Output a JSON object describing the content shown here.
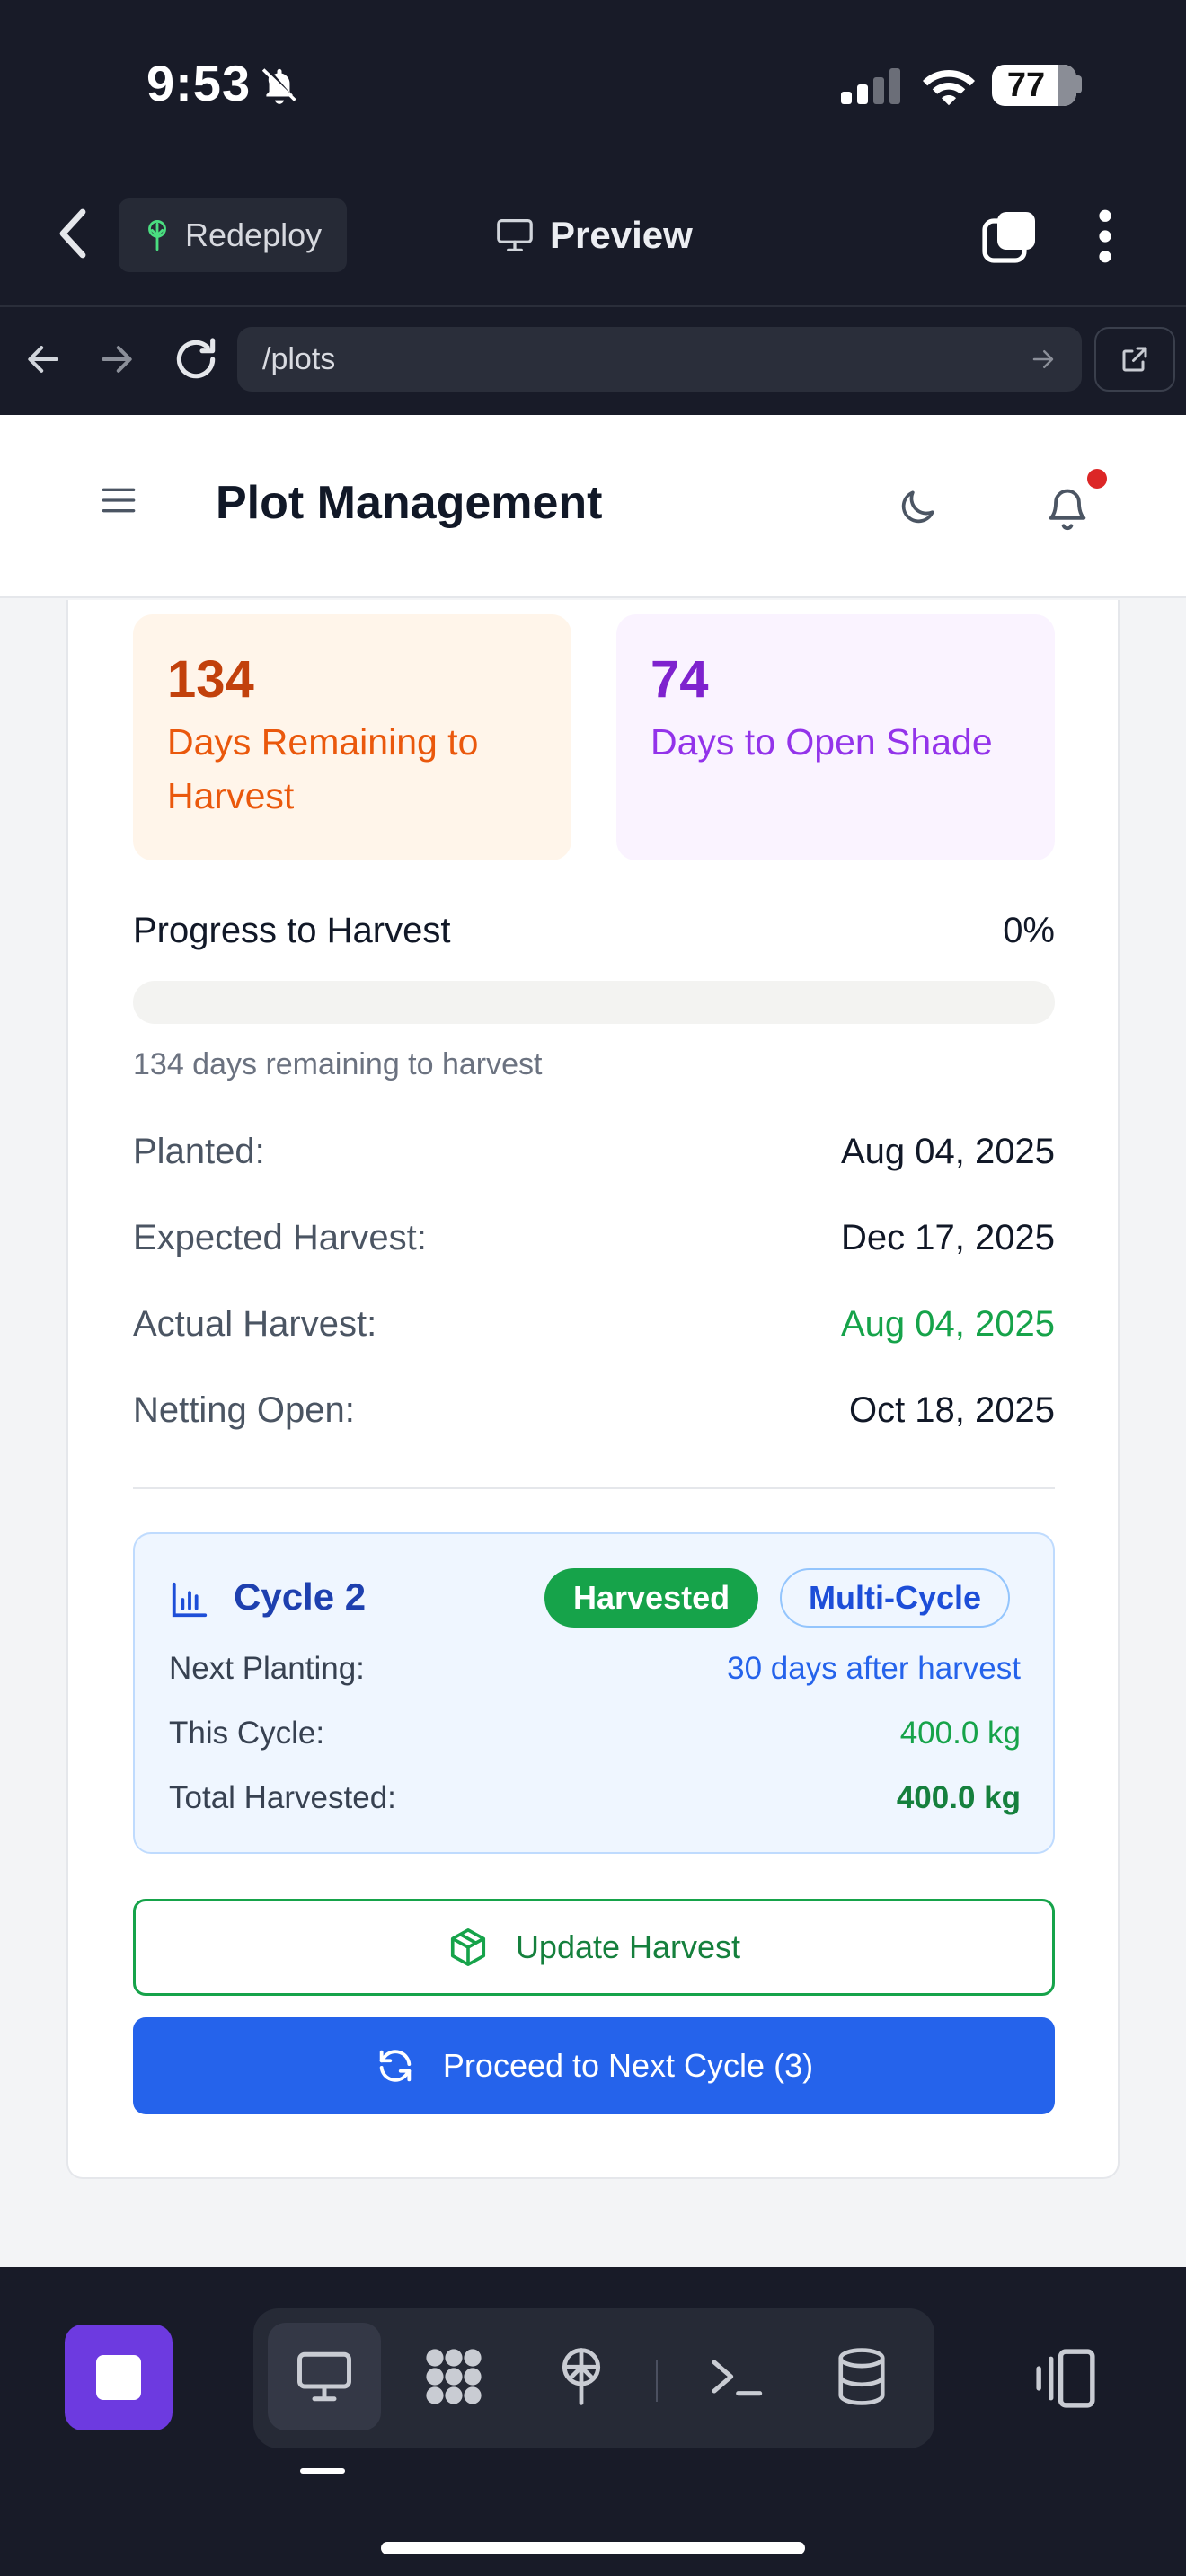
{
  "status_bar": {
    "time": "9:53",
    "battery": "77"
  },
  "browser": {
    "redeploy_label": "Redeploy",
    "preview_label": "Preview",
    "url": "/plots"
  },
  "header": {
    "title": "Plot Management"
  },
  "stats": [
    {
      "value": "134",
      "label": "Days Remaining to Harvest",
      "color": "#c2410c"
    },
    {
      "value": "74",
      "label": "Days to Open Shade",
      "color": "#7e22ce"
    }
  ],
  "progress": {
    "label": "Progress to Harvest",
    "percent_text": "0%",
    "percent": 0,
    "note": "134 days remaining to harvest"
  },
  "details": [
    {
      "key": "Planted:",
      "value": "Aug 04, 2025"
    },
    {
      "key": "Expected Harvest:",
      "value": "Dec 17, 2025"
    },
    {
      "key": "Actual Harvest:",
      "value": "Aug 04, 2025",
      "color": "#16a34a"
    },
    {
      "key": "Netting Open:",
      "value": "Oct 18, 2025"
    }
  ],
  "cycle": {
    "title": "Cycle 2",
    "badge_status": "Harvested",
    "badge_type": "Multi-Cycle",
    "rows": [
      {
        "key": "Next Planting:",
        "value": "30 days after harvest"
      },
      {
        "key": "This Cycle:",
        "value": "400.0 kg"
      },
      {
        "key": "Total Harvested:",
        "value": "400.0 kg"
      }
    ]
  },
  "actions": {
    "update_label": "Update Harvest",
    "next_label": "Proceed to Next Cycle (3)"
  },
  "dock": {
    "tools": [
      "desktop-icon",
      "apps-icon",
      "deploy-icon",
      "terminal-icon",
      "database-icon"
    ],
    "active_tool": "desktop-icon"
  },
  "colors": {
    "accent_blue": "#2563eb",
    "success_green": "#16a34a",
    "chrome_bg": "#181b28",
    "stop_purple": "#6d3ae0"
  }
}
